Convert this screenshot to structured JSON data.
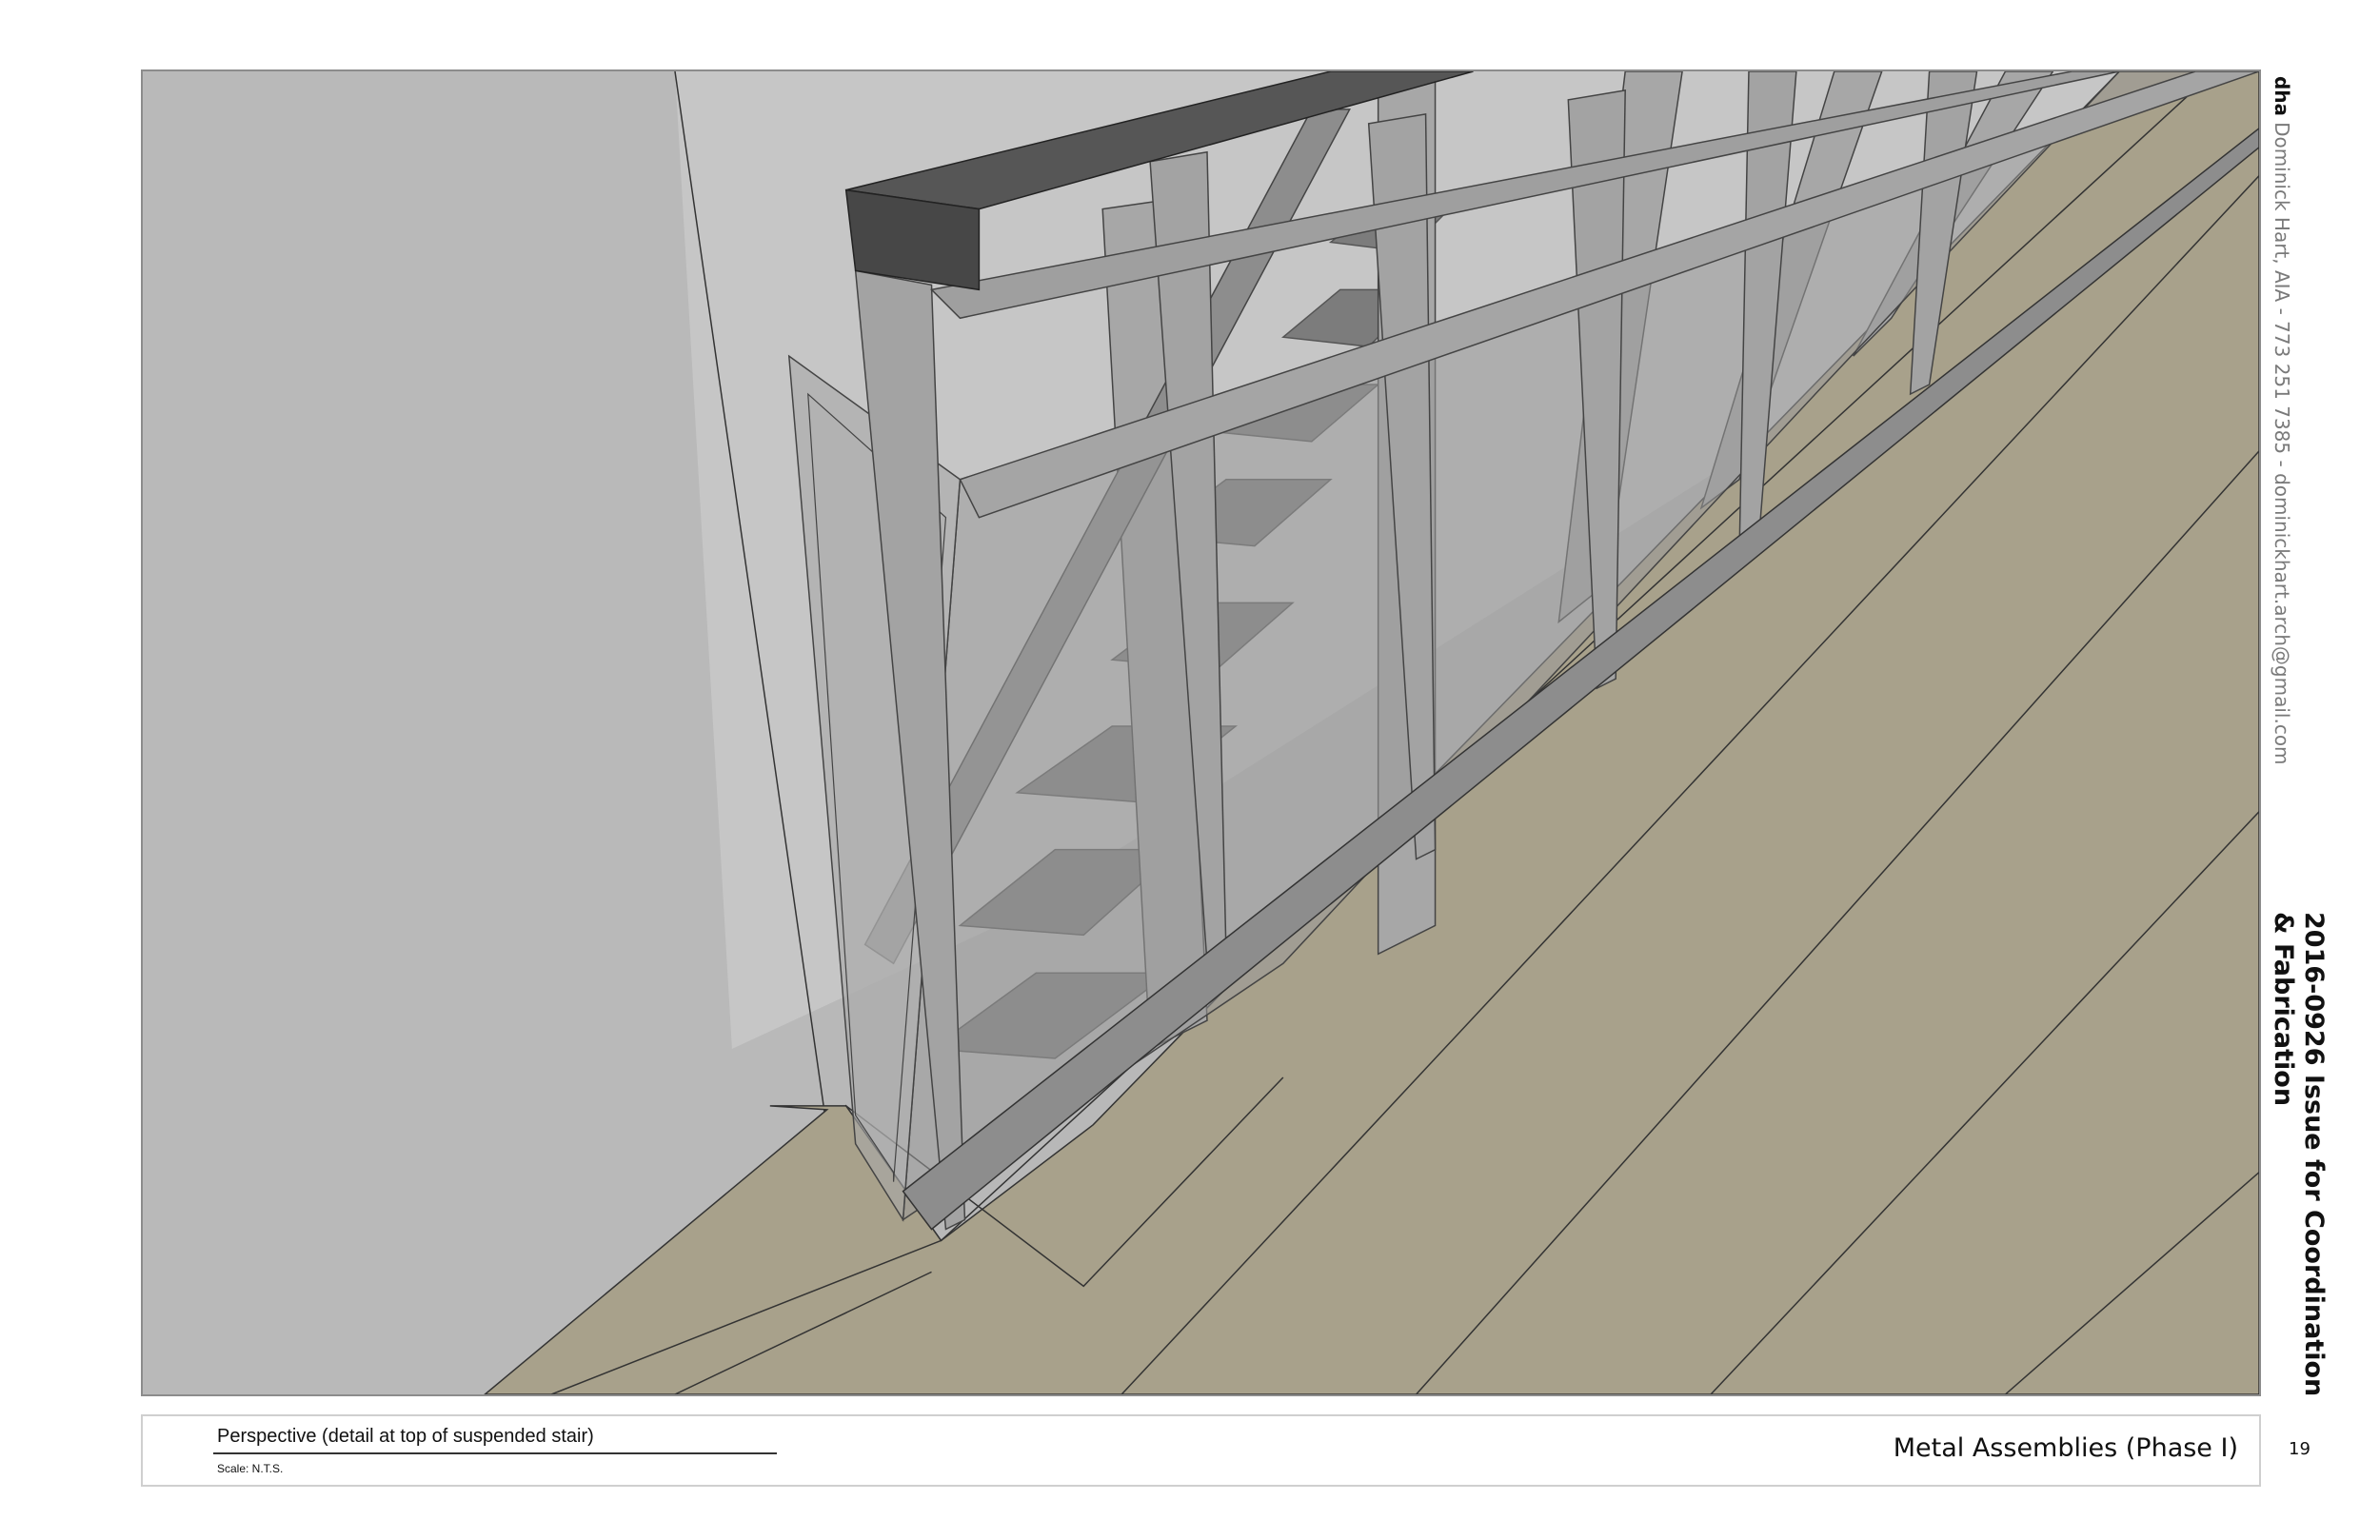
{
  "drawing": {
    "description_visible": false,
    "colors": {
      "wall": "#b8b8b8",
      "floor": "#a8a18b",
      "glass": "#9a9a9a",
      "cap": "#565656",
      "line": "#2a2a2a"
    }
  },
  "title_block": {
    "view_title": "Perspective (detail at top of suspended stair)",
    "scale": "Scale: N.T.S.",
    "sheet_name": "Metal Assemblies (Phase I)",
    "sheet_number": "19"
  },
  "side_margin": {
    "firm_logo": "dha",
    "firm_info": "Dominick Hart, AIA - 773 251 7385 - dominickhart.arch@gmail.com",
    "issue_title": "2016-0926 Issue for Coordination & Fabrication"
  }
}
